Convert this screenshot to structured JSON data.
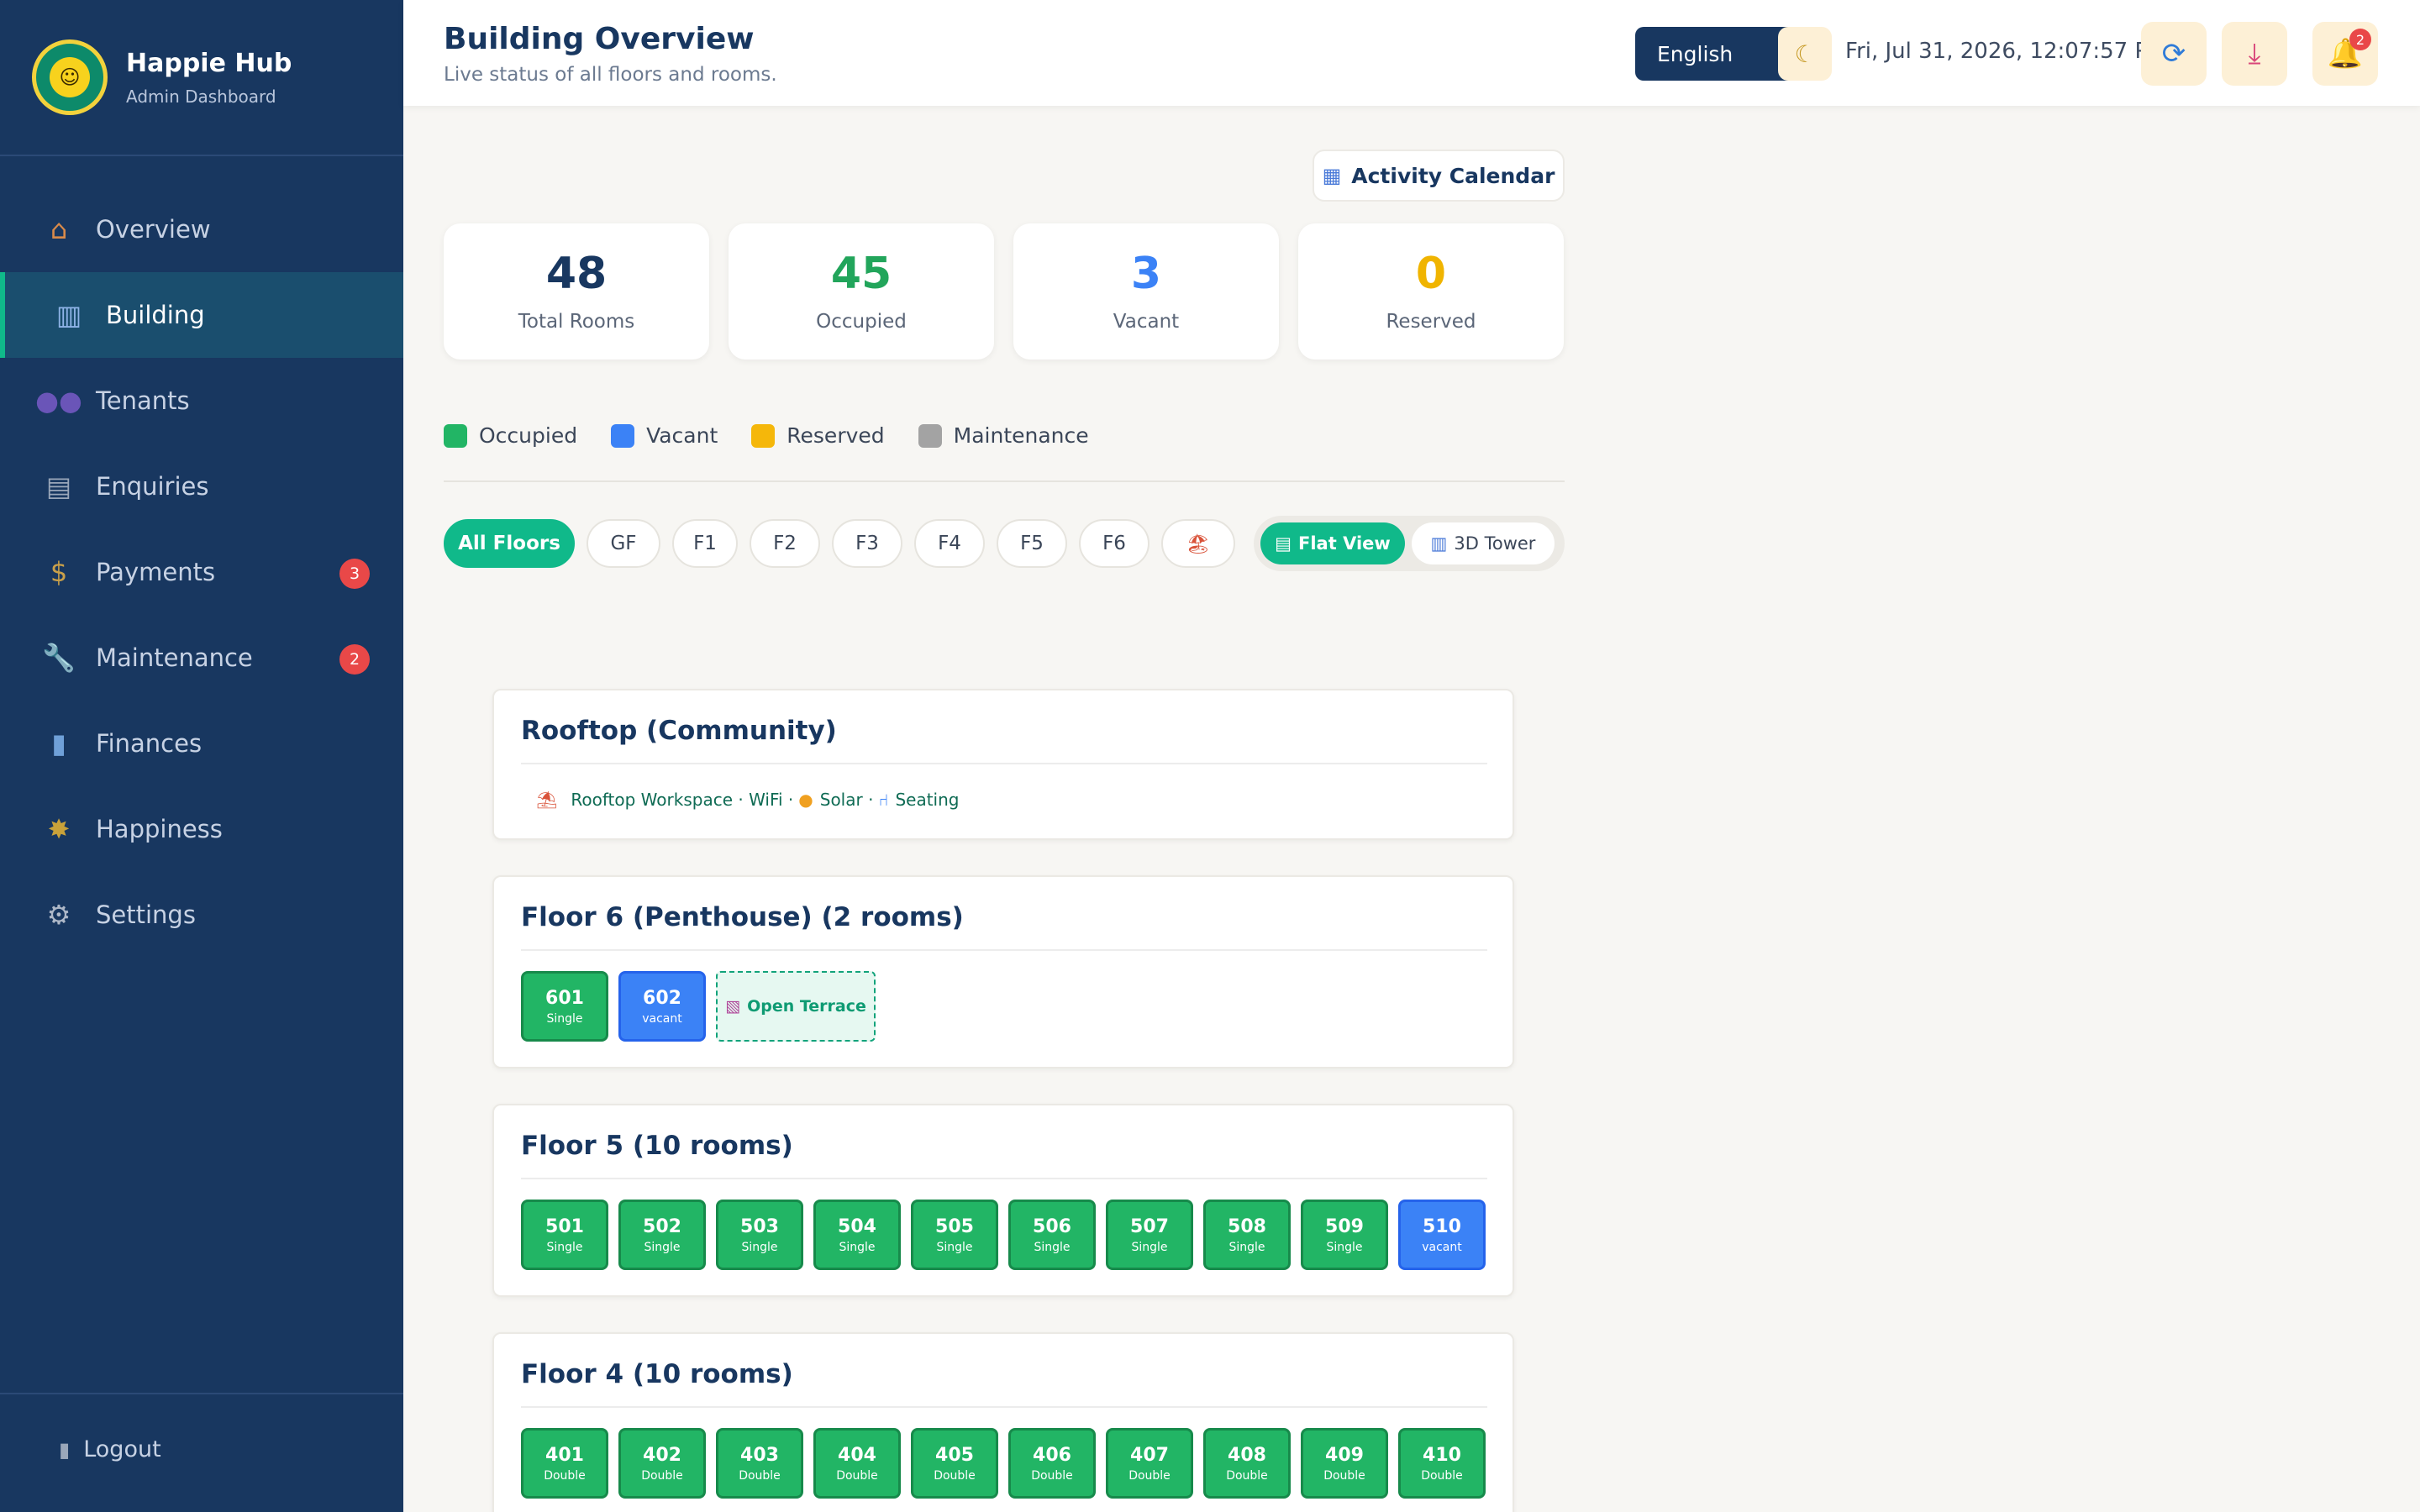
{
  "brand": {
    "title": "Happie Hub",
    "subtitle": "Admin Dashboard"
  },
  "sidebar": {
    "items": [
      {
        "label": "Overview",
        "icon": "home-icon"
      },
      {
        "label": "Building",
        "icon": "building-icon",
        "active": true
      },
      {
        "label": "Tenants",
        "icon": "people-icon"
      },
      {
        "label": "Enquiries",
        "icon": "clipboard-icon"
      },
      {
        "label": "Payments",
        "icon": "money-bag-icon",
        "badge": "3"
      },
      {
        "label": "Maintenance",
        "icon": "wrench-icon",
        "badge": "2"
      },
      {
        "label": "Finances",
        "icon": "bar-chart-icon"
      },
      {
        "label": "Happiness",
        "icon": "sun-icon"
      },
      {
        "label": "Settings",
        "icon": "gear-icon"
      }
    ],
    "logout": "Logout"
  },
  "header": {
    "title": "Building Overview",
    "subtitle": "Live status of all floors and rooms.",
    "language": "English",
    "datetime": "Fri, Jul 31, 2026, 12:07:57 PM",
    "notifications": "2"
  },
  "activity_calendar": "Activity Calendar",
  "stats": [
    {
      "value": "48",
      "label": "Total Rooms",
      "color": "#183760"
    },
    {
      "value": "45",
      "label": "Occupied",
      "color": "#22a55b"
    },
    {
      "value": "3",
      "label": "Vacant",
      "color": "#3b82f6"
    },
    {
      "value": "0",
      "label": "Reserved",
      "color": "#f0b400"
    }
  ],
  "legend": [
    {
      "label": "Occupied",
      "color": "#22b565"
    },
    {
      "label": "Vacant",
      "color": "#3b82f6"
    },
    {
      "label": "Reserved",
      "color": "#f5b70a"
    },
    {
      "label": "Maintenance",
      "color": "#a3a3a3"
    }
  ],
  "filters": [
    "All Floors",
    "GF",
    "F1",
    "F2",
    "F3",
    "F4",
    "F5",
    "F6",
    "🏖"
  ],
  "view_toggle": {
    "flat": "Flat View",
    "tower": "3D Tower"
  },
  "rooftop": {
    "title": "Rooftop (Community)",
    "info_1": "Rooftop Workspace · WiFi · ",
    "info_2": "Solar · ",
    "info_3": "Seating"
  },
  "floors": [
    {
      "title": "Floor 6 (Penthouse) (2 rooms)",
      "rooms": [
        {
          "num": "601",
          "type": "Single",
          "status": "occ"
        },
        {
          "num": "602",
          "type": "vacant",
          "status": "vac"
        }
      ],
      "terrace": "Open Terrace"
    },
    {
      "title": "Floor 5 (10 rooms)",
      "rooms": [
        {
          "num": "501",
          "type": "Single",
          "status": "occ"
        },
        {
          "num": "502",
          "type": "Single",
          "status": "occ"
        },
        {
          "num": "503",
          "type": "Single",
          "status": "occ"
        },
        {
          "num": "504",
          "type": "Single",
          "status": "occ"
        },
        {
          "num": "505",
          "type": "Single",
          "status": "occ"
        },
        {
          "num": "506",
          "type": "Single",
          "status": "occ"
        },
        {
          "num": "507",
          "type": "Single",
          "status": "occ"
        },
        {
          "num": "508",
          "type": "Single",
          "status": "occ"
        },
        {
          "num": "509",
          "type": "Single",
          "status": "occ"
        },
        {
          "num": "510",
          "type": "vacant",
          "status": "vac"
        }
      ]
    },
    {
      "title": "Floor 4 (10 rooms)",
      "rooms": [
        {
          "num": "401",
          "type": "Double",
          "status": "occ"
        },
        {
          "num": "402",
          "type": "Double",
          "status": "occ"
        },
        {
          "num": "403",
          "type": "Double",
          "status": "occ"
        },
        {
          "num": "404",
          "type": "Double",
          "status": "occ"
        },
        {
          "num": "405",
          "type": "Double",
          "status": "occ"
        },
        {
          "num": "406",
          "type": "Double",
          "status": "occ"
        },
        {
          "num": "407",
          "type": "Double",
          "status": "occ"
        },
        {
          "num": "408",
          "type": "Double",
          "status": "occ"
        },
        {
          "num": "409",
          "type": "Double",
          "status": "occ"
        },
        {
          "num": "410",
          "type": "Double",
          "status": "occ"
        }
      ]
    }
  ]
}
